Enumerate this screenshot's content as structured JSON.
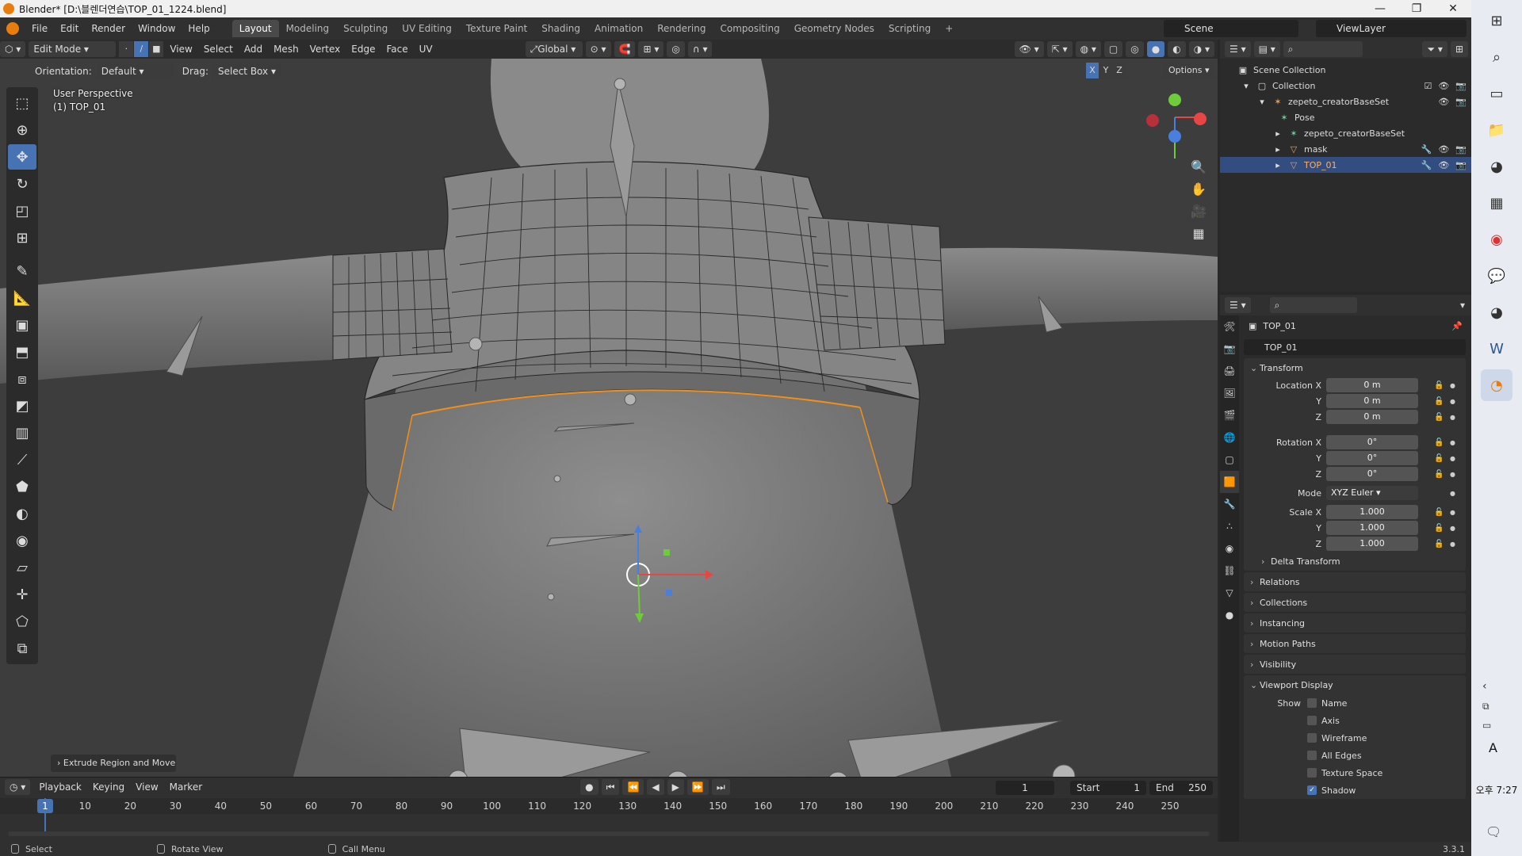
{
  "window": {
    "title": "Blender* [D:\\블렌더연습\\TOP_01_1224.blend]",
    "controls": [
      "—",
      "❐",
      "✕"
    ]
  },
  "menu": [
    "File",
    "Edit",
    "Render",
    "Window",
    "Help"
  ],
  "workspaces": [
    "Layout",
    "Modeling",
    "Sculpting",
    "UV Editing",
    "Texture Paint",
    "Shading",
    "Animation",
    "Rendering",
    "Compositing",
    "Geometry Nodes",
    "Scripting",
    "+"
  ],
  "active_workspace": "Layout",
  "scene": "Scene",
  "view_layer": "ViewLayer",
  "viewport_header": {
    "mode": "Edit Mode",
    "menus": [
      "View",
      "Select",
      "Add",
      "Mesh",
      "Vertex",
      "Edge",
      "Face",
      "UV"
    ],
    "transform": "Global",
    "orientation_label": "Orientation:",
    "orientation": "Default",
    "drag_label": "Drag:",
    "drag": "Select Box",
    "options": "Options",
    "axes": [
      "X",
      "Y",
      "Z"
    ]
  },
  "viewport_info": {
    "line1": "User Perspective",
    "line2": "(1) TOP_01"
  },
  "last_operator": "Extrude Region and Move",
  "timeline": {
    "menus": [
      "Playback",
      "Keying",
      "View",
      "Marker"
    ],
    "current_frame": "1",
    "start_label": "Start",
    "start": "1",
    "end_label": "End",
    "end": "250",
    "ticks": [
      "10",
      "20",
      "30",
      "40",
      "50",
      "60",
      "70",
      "80",
      "90",
      "100",
      "110",
      "120",
      "130",
      "140",
      "150",
      "160",
      "170",
      "180",
      "190",
      "200",
      "210",
      "220",
      "230",
      "240",
      "250"
    ],
    "playhead": "1"
  },
  "statusbar": {
    "select": "Select",
    "rotate": "Rotate View",
    "call_menu": "Call Menu",
    "version": "3.3.1"
  },
  "outliner": {
    "rows": [
      {
        "label": "Scene Collection"
      },
      {
        "label": "Collection"
      },
      {
        "label": "zepeto_creatorBaseSet"
      },
      {
        "label": "Pose"
      },
      {
        "label": "zepeto_creatorBaseSet"
      },
      {
        "label": "mask"
      },
      {
        "label": "TOP_01"
      }
    ]
  },
  "properties": {
    "object_name": "TOP_01",
    "name_field": "TOP_01",
    "transform": {
      "title": "Transform",
      "location_label": "Location X",
      "location": [
        "0 m",
        "0 m",
        "0 m"
      ],
      "rotation_label": "Rotation X",
      "rotation": [
        "0°",
        "0°",
        "0°"
      ],
      "mode_label": "Mode",
      "mode": "XYZ Euler",
      "scale_label": "Scale X",
      "scale": [
        "1.000",
        "1.000",
        "1.000"
      ],
      "y": "Y",
      "z": "Z",
      "delta": "Delta Transform"
    },
    "panels": [
      "Relations",
      "Collections",
      "Instancing",
      "Motion Paths",
      "Visibility"
    ],
    "viewport_display": {
      "title": "Viewport Display",
      "show_label": "Show",
      "options": [
        {
          "label": "Name",
          "checked": false
        },
        {
          "label": "Axis",
          "checked": false
        },
        {
          "label": "Wireframe",
          "checked": false
        },
        {
          "label": "All Edges",
          "checked": false
        },
        {
          "label": "Texture Space",
          "checked": false
        },
        {
          "label": "Shadow",
          "checked": true
        }
      ]
    }
  },
  "taskbar": {
    "clock": "오후 7:27",
    "ime": "A"
  },
  "colors": {
    "accent": "#4772b3",
    "selected_row": "#334d80",
    "edge_select": "#f0901c",
    "blender_orange": "#e87d0d"
  }
}
